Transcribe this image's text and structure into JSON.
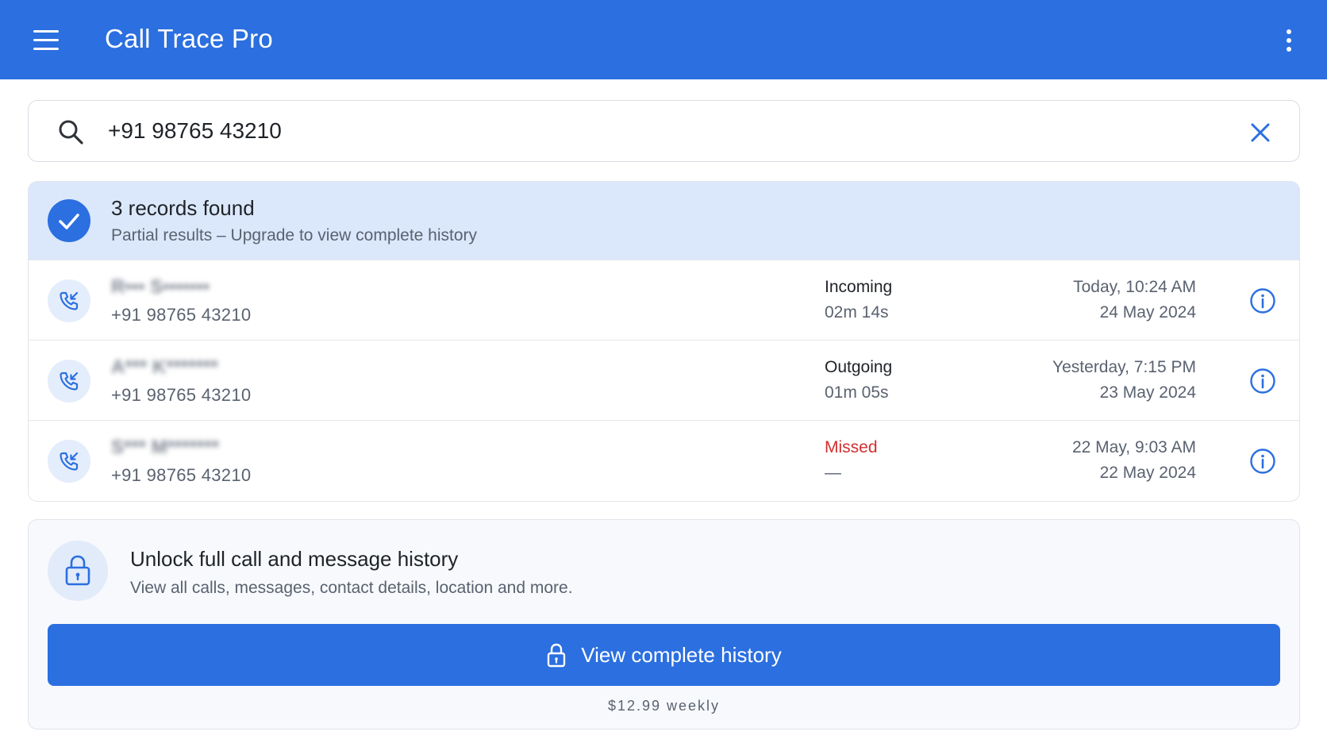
{
  "app": {
    "title": "Call Trace Pro"
  },
  "search": {
    "value": "+91 98765 43210"
  },
  "results": {
    "summary_title": "3 records found",
    "summary_subtitle": "Partial results – Upgrade to view complete history",
    "rows": [
      {
        "name": "R••• S•••••••",
        "number": "+91 98765 43210",
        "type": "Incoming",
        "duration": "02m 14s",
        "time": "Today, 10:24 AM",
        "date": "24 May 2024"
      },
      {
        "name": "A*** K*******",
        "number": "+91 98765 43210",
        "type": "Outgoing",
        "duration": "01m 05s",
        "time": "Yesterday, 7:15 PM",
        "date": "23 May 2024"
      },
      {
        "name": "S*** M*******",
        "number": "+91 98765 43210",
        "type": "Missed",
        "duration": "—",
        "time": "22 May, 9:03 AM",
        "date": "22 May 2024"
      }
    ]
  },
  "unlock": {
    "title": "Unlock full call and message history",
    "subtitle": "View all calls, messages, contact details, location and more.",
    "cta_label": "View complete history",
    "price": "$12.99 weekly"
  },
  "colors": {
    "primary": "#2b6fe0",
    "banner_bg": "#dbe8fb",
    "missed": "#d32f2f"
  },
  "icons": {
    "menu": "hamburger-icon",
    "more": "more-vertical-icon",
    "search": "search-icon",
    "clear": "close-icon",
    "check": "check-icon",
    "call": "phone-incoming-icon",
    "info": "info-icon",
    "lock": "lock-icon"
  }
}
